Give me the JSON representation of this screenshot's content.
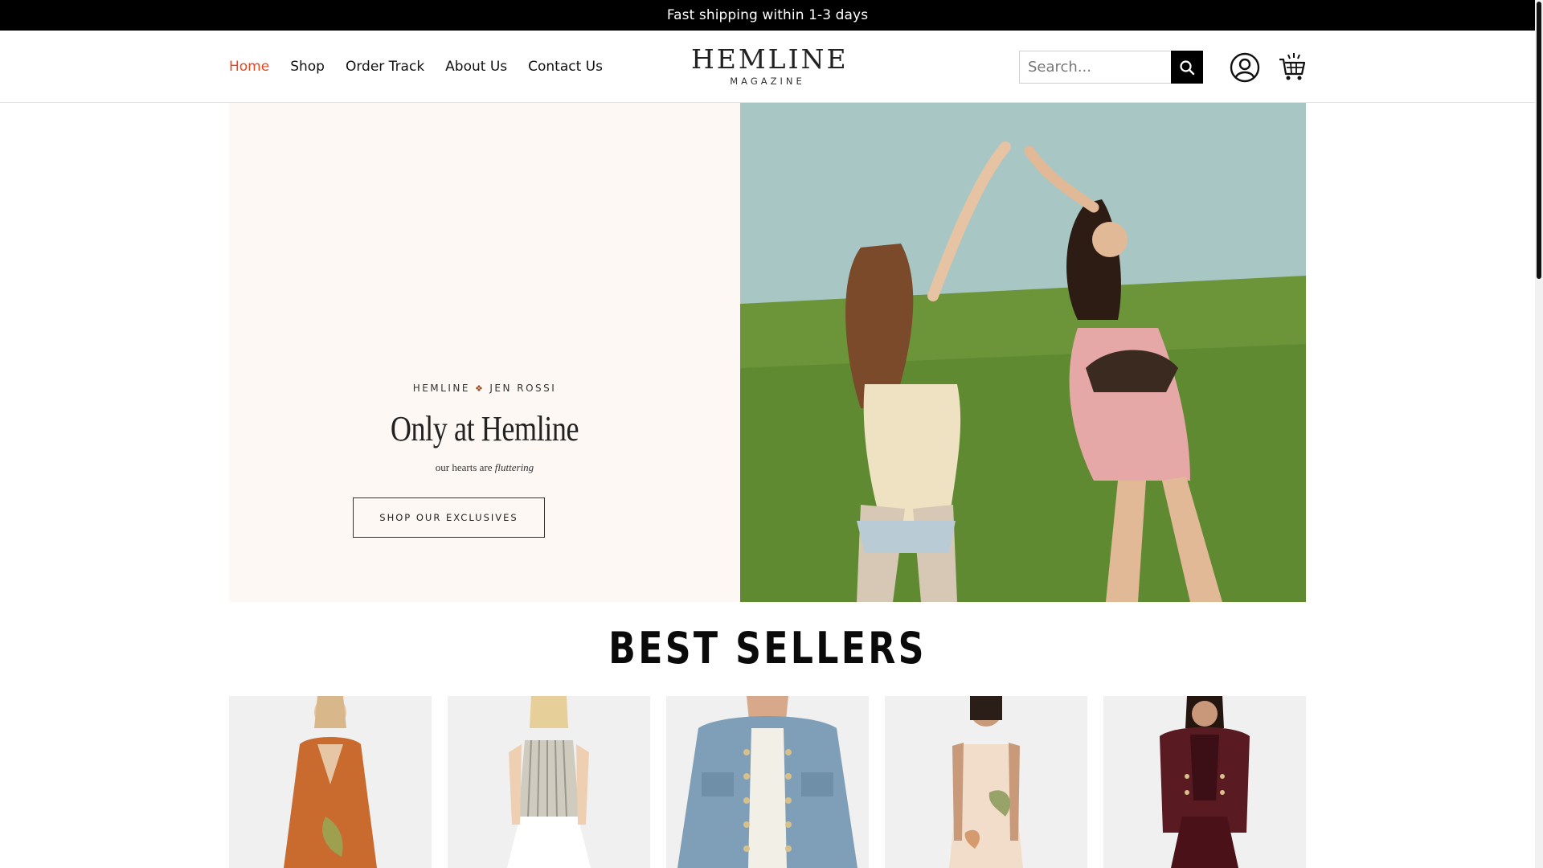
{
  "announcement": {
    "text": "Fast shipping within 1-3 days"
  },
  "nav": {
    "items": [
      {
        "label": "Home",
        "active": true
      },
      {
        "label": "Shop",
        "active": false
      },
      {
        "label": "Order Track",
        "active": false
      },
      {
        "label": "About Us",
        "active": false
      },
      {
        "label": "Contact Us",
        "active": false
      }
    ]
  },
  "logo": {
    "main": "HEMLINE",
    "sub": "MAGAZINE"
  },
  "search": {
    "placeholder": "Search...",
    "value": ""
  },
  "icons": {
    "search": "search-icon",
    "account": "account-icon",
    "cart": "cart-icon",
    "butterfly": "butterfly-icon"
  },
  "hero": {
    "collab_left": "HEMLINE",
    "collab_right": "JEN ROSSI",
    "title": "Only at Hemline",
    "subtitle_plain": "our hearts are",
    "subtitle_italic": "fluttering",
    "cta": "SHOP OUR EXCLUSIVES"
  },
  "best_sellers": {
    "title": "BEST SELLERS",
    "products": [
      {
        "name": "orange strapless dress",
        "color": "#c96a2e"
      },
      {
        "name": "striped vest with white skirt",
        "color": "#d9d5cb"
      },
      {
        "name": "denim jacket",
        "color": "#7f9fb8"
      },
      {
        "name": "floral strapless dress",
        "color": "#f1ddc9"
      },
      {
        "name": "burgundy leather jacket set",
        "color": "#5a1a22"
      }
    ]
  },
  "colors": {
    "accent": "#e8461c",
    "announcement_bg": "#000000",
    "hero_bg": "#fdf8f3"
  }
}
